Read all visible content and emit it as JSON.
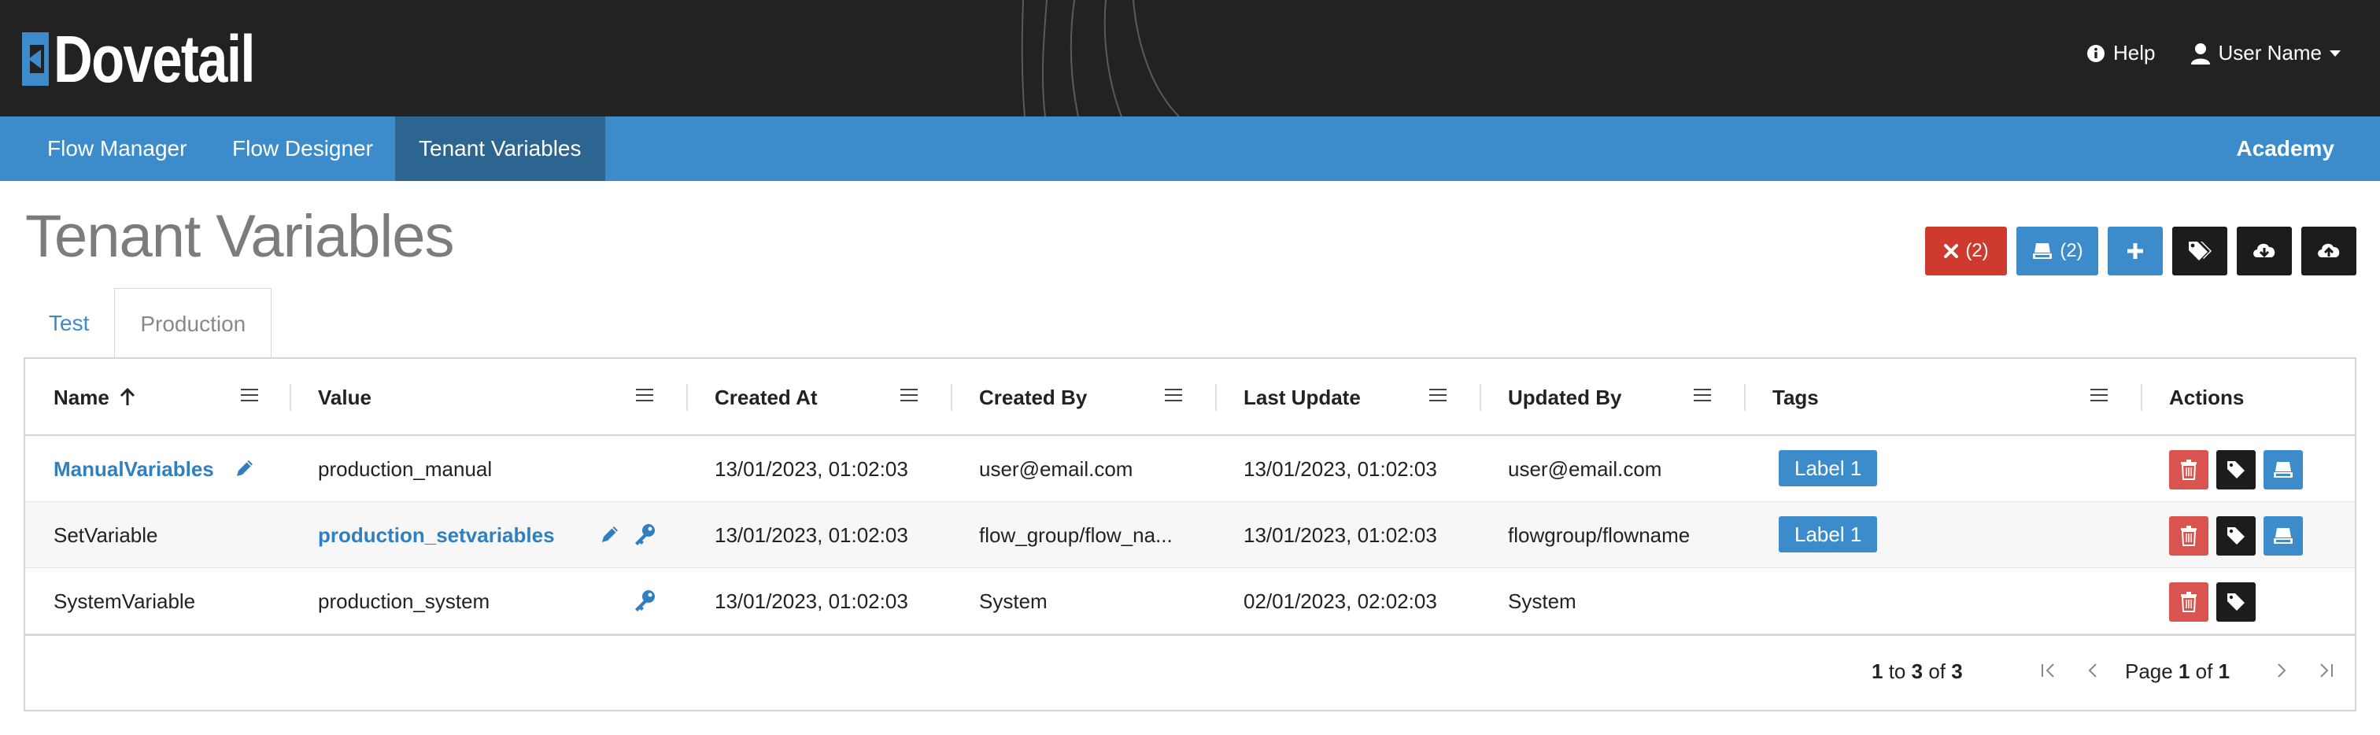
{
  "brand": {
    "name": "Dovetail",
    "accent": "#3c8ccc"
  },
  "header": {
    "help_label": "Help",
    "user_label": "User Name"
  },
  "nav": {
    "items": [
      {
        "label": "Flow Manager"
      },
      {
        "label": "Flow Designer"
      },
      {
        "label": "Tenant Variables"
      }
    ],
    "active_index": 2,
    "right_label": "Academy"
  },
  "page": {
    "title": "Tenant Variables",
    "actions": {
      "delete_count": "(2)",
      "deploy_count": "(2)",
      "icons": [
        "times-icon",
        "deploy-icon",
        "plus-icon",
        "tags-icon",
        "cloud-download-icon",
        "cloud-upload-icon"
      ]
    }
  },
  "tabs": [
    {
      "label": "Test"
    },
    {
      "label": "Production"
    }
  ],
  "active_tab": 1,
  "grid": {
    "columns": [
      "Name",
      "Value",
      "Created At",
      "Created By",
      "Last Update",
      "Updated By",
      "Tags",
      "Actions"
    ],
    "sort": {
      "column": "Name",
      "direction": "ascending"
    },
    "rows": [
      {
        "name": "ManualVariables",
        "value": "production_manual",
        "created_at": "13/01/2023, 01:02:03",
        "created_by": "user@email.com",
        "last_update": "13/01/2023, 01:02:03",
        "updated_by": "user@email.com",
        "tag": "Label 1"
      },
      {
        "name": "SetVariable",
        "value": "production_setvariables",
        "created_at": "13/01/2023, 01:02:03",
        "created_by": "flow_group/flow_na...",
        "last_update": "13/01/2023, 01:02:03",
        "updated_by": "flowgroup/flowname",
        "tag": "Label 1"
      },
      {
        "name": "SystemVariable",
        "value": "production_system",
        "created_at": "13/01/2023, 01:02:03",
        "created_by": "System",
        "last_update": "02/01/2023, 02:02:03",
        "updated_by": "System",
        "tag": ""
      }
    ],
    "footer": {
      "from": "1",
      "to_word": "to",
      "to": "3",
      "of_word": "of",
      "total": "3",
      "page_word": "Page",
      "page": "1",
      "page_of_word": "of",
      "page_total": "1"
    }
  }
}
